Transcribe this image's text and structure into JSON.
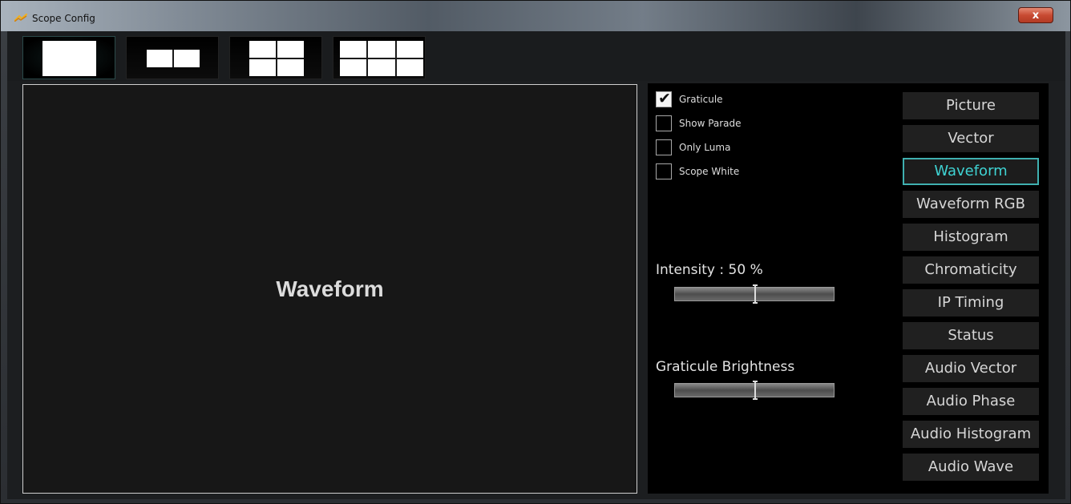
{
  "window": {
    "title": "Scope Config",
    "close_label": "x"
  },
  "layouts": [
    {
      "name": "single",
      "panes": 1,
      "active": true
    },
    {
      "name": "dual",
      "panes": 2,
      "active": false
    },
    {
      "name": "quad",
      "panes": 4,
      "active": false
    },
    {
      "name": "six",
      "panes": 6,
      "active": false
    }
  ],
  "preview": {
    "label": "Waveform"
  },
  "options": {
    "checkboxes": [
      {
        "label": "Graticule",
        "checked": true
      },
      {
        "label": "Show Parade",
        "checked": false
      },
      {
        "label": "Only Luma",
        "checked": false
      },
      {
        "label": "Scope White",
        "checked": false
      }
    ],
    "intensity": {
      "label": "Intensity : 50 %",
      "value": 50
    },
    "graticule_brightness": {
      "label": "Graticule Brightness",
      "value": 50
    }
  },
  "scope_types": [
    {
      "label": "Picture",
      "active": false
    },
    {
      "label": "Vector",
      "active": false
    },
    {
      "label": "Waveform",
      "active": true
    },
    {
      "label": "Waveform RGB",
      "active": false
    },
    {
      "label": "Histogram",
      "active": false
    },
    {
      "label": "Chromaticity",
      "active": false
    },
    {
      "label": "IP Timing",
      "active": false
    },
    {
      "label": "Status",
      "active": false
    },
    {
      "label": "Audio Vector",
      "active": false
    },
    {
      "label": "Audio Phase",
      "active": false
    },
    {
      "label": "Audio Histogram",
      "active": false
    },
    {
      "label": "Audio Wave",
      "active": false
    }
  ],
  "colors": {
    "accent": "#3fd3d3",
    "panel_bg": "#000000",
    "button_bg": "#202020"
  }
}
